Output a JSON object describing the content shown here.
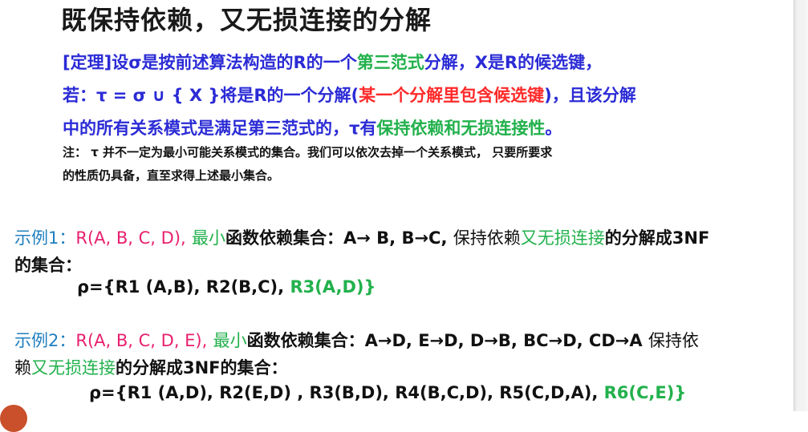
{
  "title": "既保持依赖，又无损连接的分解",
  "theorem": {
    "l1a": "[定理]设σ是按前述算法构造的R的一个",
    "l1b": "第三范式",
    "l1c": "分解，X是R的候选键，",
    "l2a": "若：τ = σ ∪ { X }将是R的一个分解(",
    "l2b": "某一个分解里包含候选键",
    "l2c": ")，且该分解",
    "l3a": "中的所有关系模式是满足第三范式的，τ有",
    "l3b": "保持依赖和无损连接性",
    "l3c": "。"
  },
  "note": {
    "l1": "注： τ  并不一定为最小可能关系模式的集合。我们可以依次去掉一个关系模式， 只要所要求",
    "l2": "的性质仍具备，直至求得上述最小集合。"
  },
  "example1": {
    "label": "示例1：",
    "relation": "R(A, B, C, D),",
    "minimal": "最小",
    "text1": "函数依赖集合：A→ B, B→C,",
    "text2": "保持依赖",
    "lossless": "又无损连接",
    "text3": "的分解成3NF",
    "line2": "的集合：",
    "rho_a": "ρ={R1 (A,B), R2(B,C),",
    "rho_b": "R3(A,D)}"
  },
  "example2": {
    "label": "示例2：",
    "relation": "R(A, B, C, D, E),",
    "minimal": "最小",
    "text1": "函数依赖集合：A→D, E→D, D→B,  BC→D,  CD→A",
    "text2": "保持依",
    "line2a": "赖",
    "lossless": "又无损连接",
    "line2b": "的分解成3NF的集合：",
    "rho_a": "ρ={R1 (A,D), R2(E,D) , R3(B,D), R4(B,C,D), R5(C,D,A),",
    "rho_b": "R6(C,E)}"
  },
  "colors": {
    "theorem_blue": "#2b2bd6",
    "red": "#ff2a2a",
    "green": "#22b14c",
    "relation_pink": "#e8206e",
    "label_blue": "#1f7fc0"
  }
}
